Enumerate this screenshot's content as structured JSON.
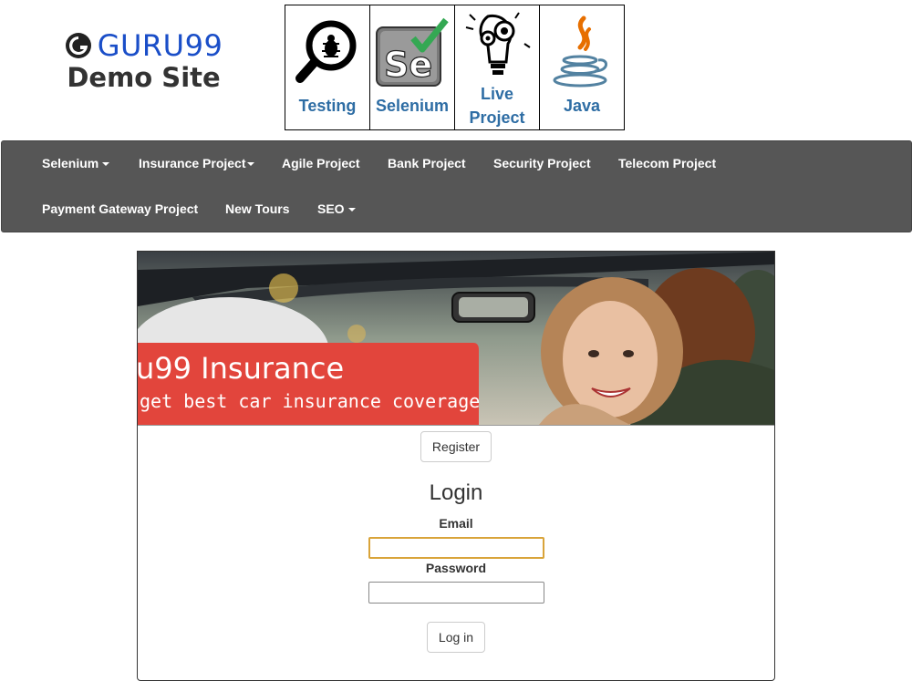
{
  "header": {
    "logo_name": "GURU99",
    "logo_sub": "Demo Site",
    "tiles": [
      {
        "label_line1": "Testing",
        "label_line2": "",
        "icon": "bug-magnifier-icon"
      },
      {
        "label_line1": "Selenium",
        "label_line2": "",
        "icon": "selenium-icon"
      },
      {
        "label_line1": "Live",
        "label_line2": "Project",
        "icon": "lightbulb-gears-icon"
      },
      {
        "label_line1": "Java",
        "label_line2": "",
        "icon": "java-icon"
      }
    ]
  },
  "nav": {
    "row1": [
      "Selenium",
      "Insurance Project",
      "Agile Project",
      "Bank Project",
      "Security Project",
      "Telecom Project"
    ],
    "row2": [
      "Payment Gateway Project",
      "New Tours",
      "SEO"
    ]
  },
  "banner": {
    "title": "u99 Insurance",
    "subtitle": "get best car insurance coverage"
  },
  "form": {
    "register_label": "Register",
    "login_title": "Login",
    "email_label": "Email",
    "email_value": "",
    "password_label": "Password",
    "password_value": "",
    "login_button": "Log in"
  },
  "colors": {
    "logo_blue": "#1a4ec8",
    "tile_label": "#2e6da4",
    "navbar": "#565656",
    "banner_red": "#e2453c",
    "focus_border": "#d9a43a"
  }
}
